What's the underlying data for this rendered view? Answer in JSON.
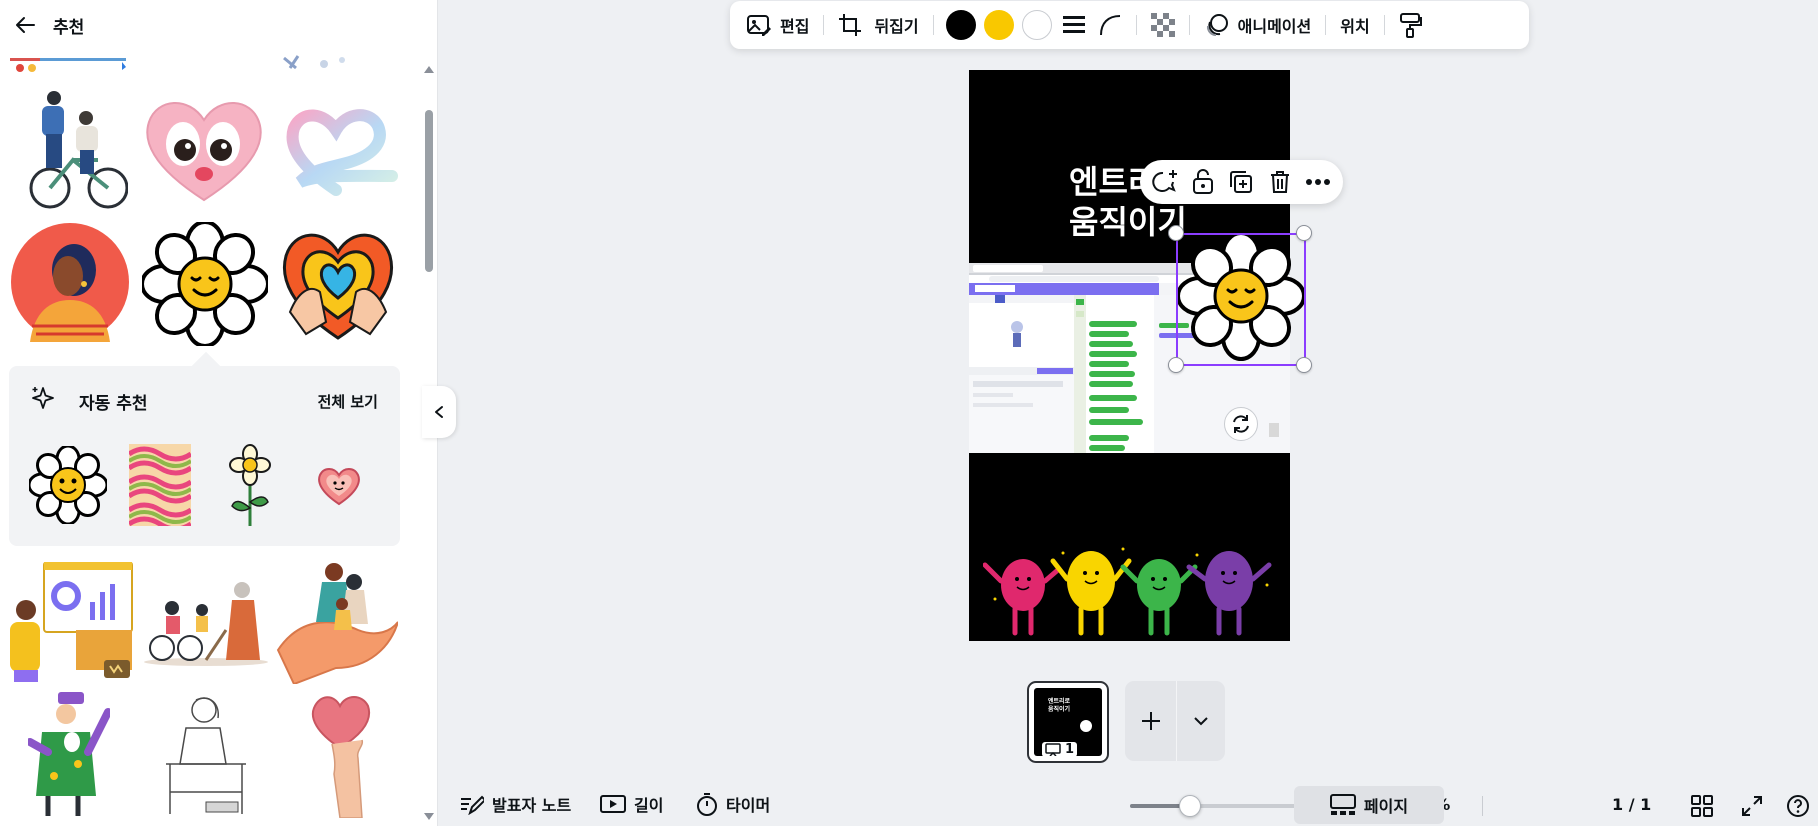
{
  "left_panel": {
    "title": "추천",
    "auto_recommend": {
      "title": "자동 추천",
      "view_all": "전체 보기"
    }
  },
  "toolbar": {
    "edit": "편집",
    "flip": "뒤집기",
    "animation": "애니메이션",
    "position": "위치",
    "colors": [
      "#000000",
      "#f9c800",
      "#ffffff"
    ]
  },
  "canvas": {
    "title": "엔트리\n움직이기"
  },
  "page_thumbnail": {
    "title": "엔트리로\n움직이기",
    "number": "1"
  },
  "bottom_bar": {
    "speaker_notes": "발표자 노트",
    "duration": "길이",
    "timer": "타이머",
    "zoom": 0.24,
    "zoom_label": "24%",
    "pages": "페이지",
    "page_count": "1 / 1"
  }
}
